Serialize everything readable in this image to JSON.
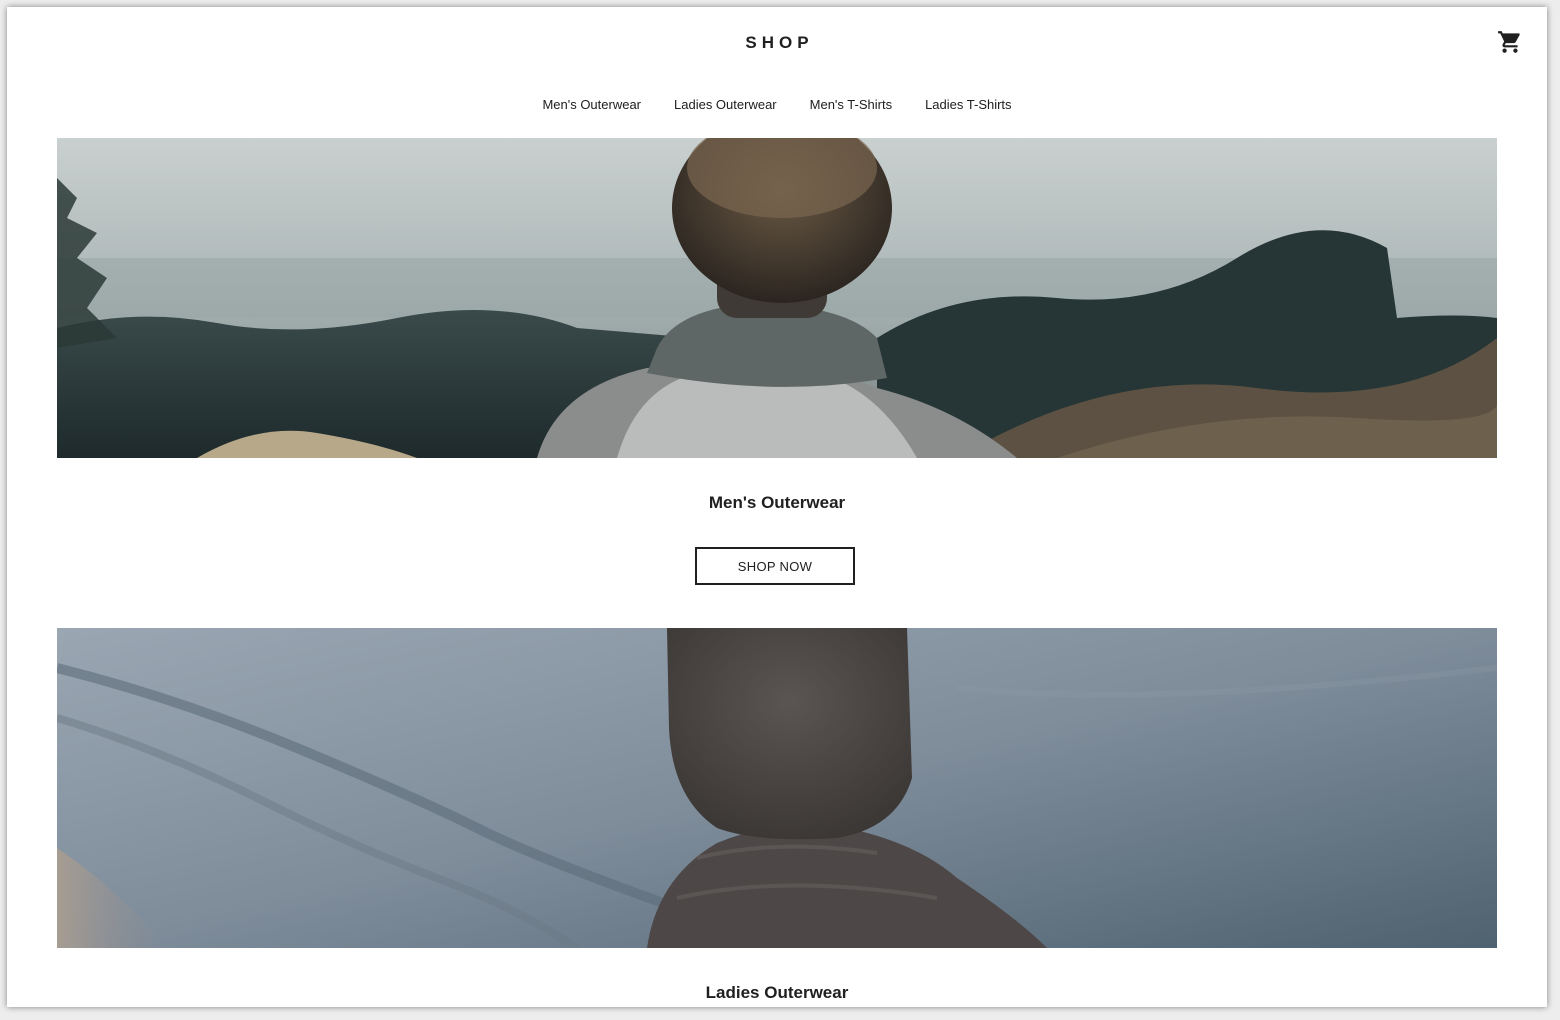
{
  "header": {
    "logo": "SHOP",
    "cart_icon": "shopping-cart-icon"
  },
  "nav": {
    "items": [
      {
        "label": "Men's Outerwear"
      },
      {
        "label": "Ladies Outerwear"
      },
      {
        "label": "Men's T-Shirts"
      },
      {
        "label": "Ladies T-Shirts"
      }
    ]
  },
  "sections": [
    {
      "title": "Men's Outerwear",
      "button_label": "SHOP NOW"
    },
    {
      "title": "Ladies Outerwear"
    }
  ]
}
